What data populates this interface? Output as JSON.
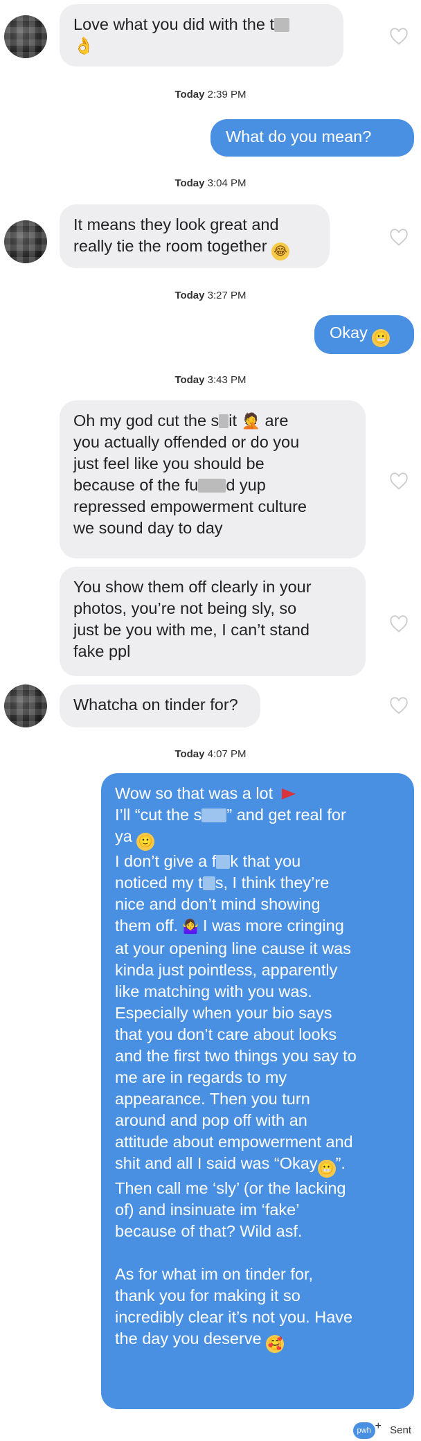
{
  "messages": {
    "m1": {
      "line1": "Love what you did with the t",
      "line1_end": ""
    },
    "ts1": {
      "day": "Today",
      "time": "2:39 PM"
    },
    "m2": {
      "text": "What do you mean?"
    },
    "ts2": {
      "day": "Today",
      "time": "3:04 PM"
    },
    "m3": {
      "line1": "It means they look great and",
      "line2": "really tie the room together"
    },
    "ts3": {
      "day": "Today",
      "time": "3:27 PM"
    },
    "m4": {
      "text": "Okay"
    },
    "ts4": {
      "day": "Today",
      "time": "3:43 PM"
    },
    "m5": {
      "p1": "Oh my god cut the s",
      "p2": "it",
      "p3": "are",
      "rest": "you actually offended or do you\njust feel like you should be\nbecause of the fu",
      "rest2": "d yup\nrepressed empowerment culture\nwe sound day to day"
    },
    "m6": {
      "text": "You show them off clearly in your\nphotos, you’re not being sly, so\njust be you with me, I can’t stand\nfake ppl"
    },
    "m7": {
      "text": "Whatcha on tinder for?"
    },
    "ts5": {
      "day": "Today",
      "time": "4:07 PM"
    },
    "m8": {
      "l1": "Wow so that was a lot",
      "l2a": "I’ll “cut the s",
      "l2b": "” and get real for",
      "l3": "ya",
      "l4a": "I don’t give a f",
      "l4b": "k that you",
      "l5a": "noticed my t",
      "l5b": "s, I think they’re",
      "l6": "nice and don’t mind showing",
      "l7a": "them off.",
      "l7b": "I was more cringing",
      "body": "at your opening line cause it was\nkinda just pointless, apparently\nlike matching with you was.\nEspecially when your bio says\nthat you don’t care about looks\nand the first two things you say to\nme are in regards to my\nappearance. Then you turn\naround and pop off with an\nattitude about empowerment and",
      "l18a": "shit and all I said was “Okay",
      "l18b": "”.",
      "body2": "Then call me ‘sly’ (or the lacking\nof) and insinuate im ‘fake’\nbecause of that? Wild asf.",
      "body3": "As for what im on tinder for,\nthank you for making it so\nincredibly clear it’s not you. Have",
      "l_last": "the day you deserve"
    }
  },
  "footer": {
    "badge": "pwh",
    "plus": "+",
    "status": "Sent"
  },
  "colors": {
    "outgoing": "#4a90e2",
    "incoming": "#eeeef1"
  }
}
